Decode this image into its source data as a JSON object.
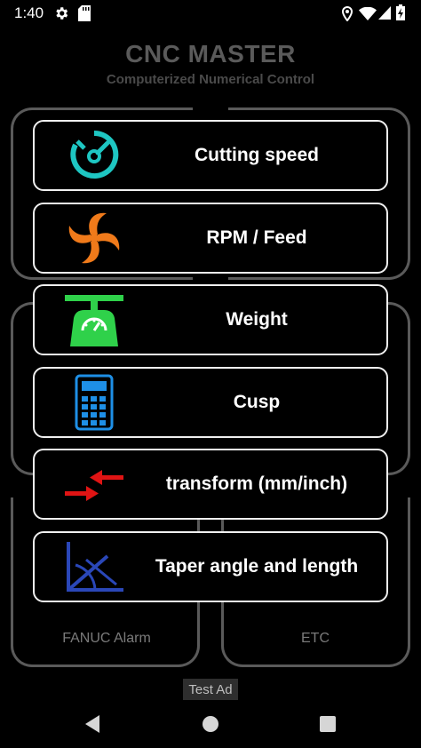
{
  "status_bar": {
    "time": "1:40",
    "icons": [
      "settings-gear-icon",
      "sd-card-icon",
      "location-pin-icon",
      "wifi-icon",
      "signal-icon",
      "battery-charging-icon"
    ]
  },
  "header": {
    "title": "CNC MASTER",
    "subtitle": "Computerized Numerical Control"
  },
  "menu": {
    "items": [
      {
        "label": "Cutting speed",
        "icon": "speedometer-icon",
        "color": "#1ec6c2"
      },
      {
        "label": "RPM / Feed",
        "icon": "spinning-cutter-icon",
        "color": "#f07a1a"
      },
      {
        "label": "Weight",
        "icon": "weighing-scale-icon",
        "color": "#2fd14a"
      },
      {
        "label": "Cusp",
        "icon": "calculator-icon",
        "color": "#1e8fe6"
      },
      {
        "label": "transform (mm/inch)",
        "icon": "conversion-arrows-icon",
        "color": "#e01414"
      },
      {
        "label": "Taper angle and length",
        "icon": "angle-icon",
        "color": "#2a47b8"
      }
    ]
  },
  "bottom": {
    "fanuc_label": "FANUC Alarm",
    "etc_label": "ETC"
  },
  "ad": {
    "label": "Test Ad"
  },
  "navbar": {
    "buttons": [
      "back-icon",
      "home-icon",
      "recents-icon"
    ]
  }
}
